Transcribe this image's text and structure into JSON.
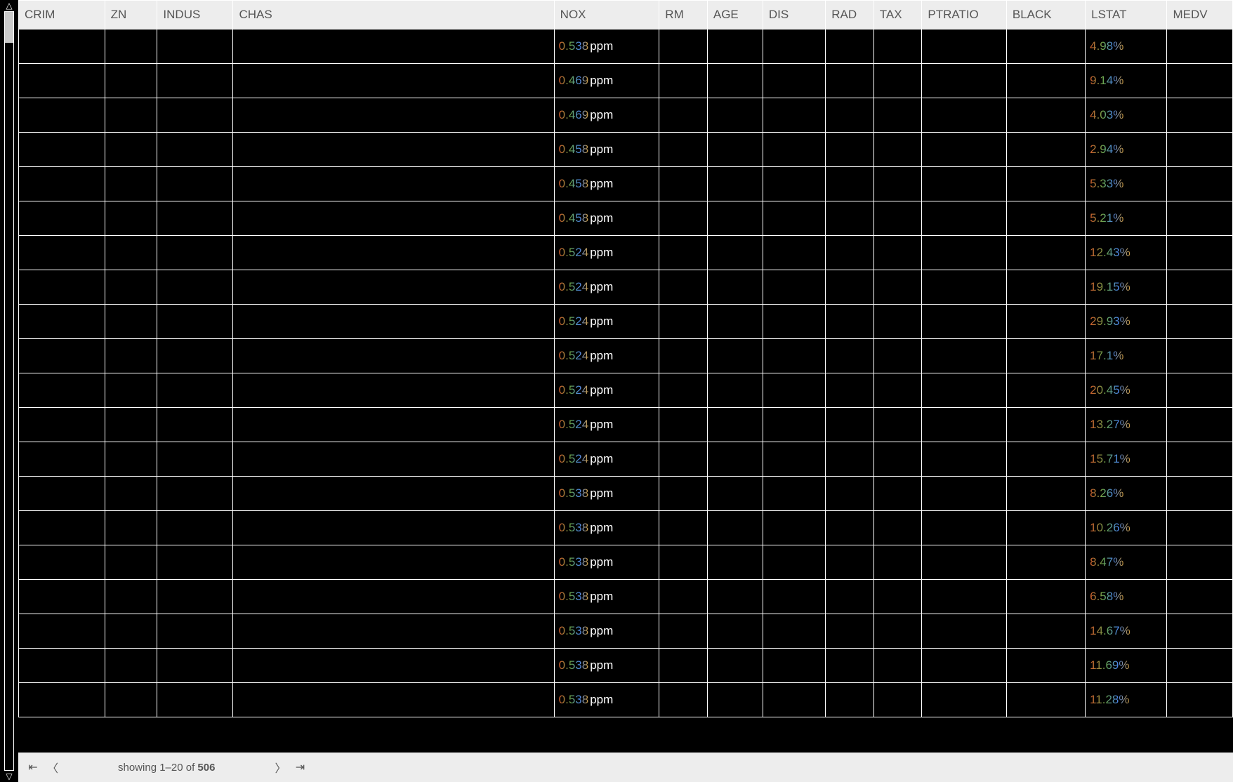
{
  "scrollbar": {
    "up_glyph": "△",
    "down_glyph": "▽"
  },
  "columns": [
    "CRIM",
    "ZN",
    "INDUS",
    "CHAS",
    "NOX",
    "RM",
    "AGE",
    "DIS",
    "RAD",
    "TAX",
    "PTRATIO",
    "BLACK",
    "LSTAT",
    "MEDV"
  ],
  "nox_unit": "ppm",
  "lstat_unit": "%",
  "rows": [
    {
      "nox": "0.538",
      "lstat": "4.98"
    },
    {
      "nox": "0.469",
      "lstat": "9.14"
    },
    {
      "nox": "0.469",
      "lstat": "4.03"
    },
    {
      "nox": "0.458",
      "lstat": "2.94"
    },
    {
      "nox": "0.458",
      "lstat": "5.33"
    },
    {
      "nox": "0.458",
      "lstat": "5.21"
    },
    {
      "nox": "0.524",
      "lstat": "12.43"
    },
    {
      "nox": "0.524",
      "lstat": "19.15"
    },
    {
      "nox": "0.524",
      "lstat": "29.93"
    },
    {
      "nox": "0.524",
      "lstat": "17.1"
    },
    {
      "nox": "0.524",
      "lstat": "20.45"
    },
    {
      "nox": "0.524",
      "lstat": "13.27"
    },
    {
      "nox": "0.524",
      "lstat": "15.71"
    },
    {
      "nox": "0.538",
      "lstat": "8.26"
    },
    {
      "nox": "0.538",
      "lstat": "10.26"
    },
    {
      "nox": "0.538",
      "lstat": "8.47"
    },
    {
      "nox": "0.538",
      "lstat": "6.58"
    },
    {
      "nox": "0.538",
      "lstat": "14.67"
    },
    {
      "nox": "0.538",
      "lstat": "11.69"
    },
    {
      "nox": "0.538",
      "lstat": "11.28"
    }
  ],
  "pager": {
    "first_glyph": "⇤",
    "prev_glyph": "〈",
    "next_glyph": "〉",
    "last_glyph": "⇥",
    "status_prefix": "showing 1–20 of ",
    "total": "506"
  }
}
